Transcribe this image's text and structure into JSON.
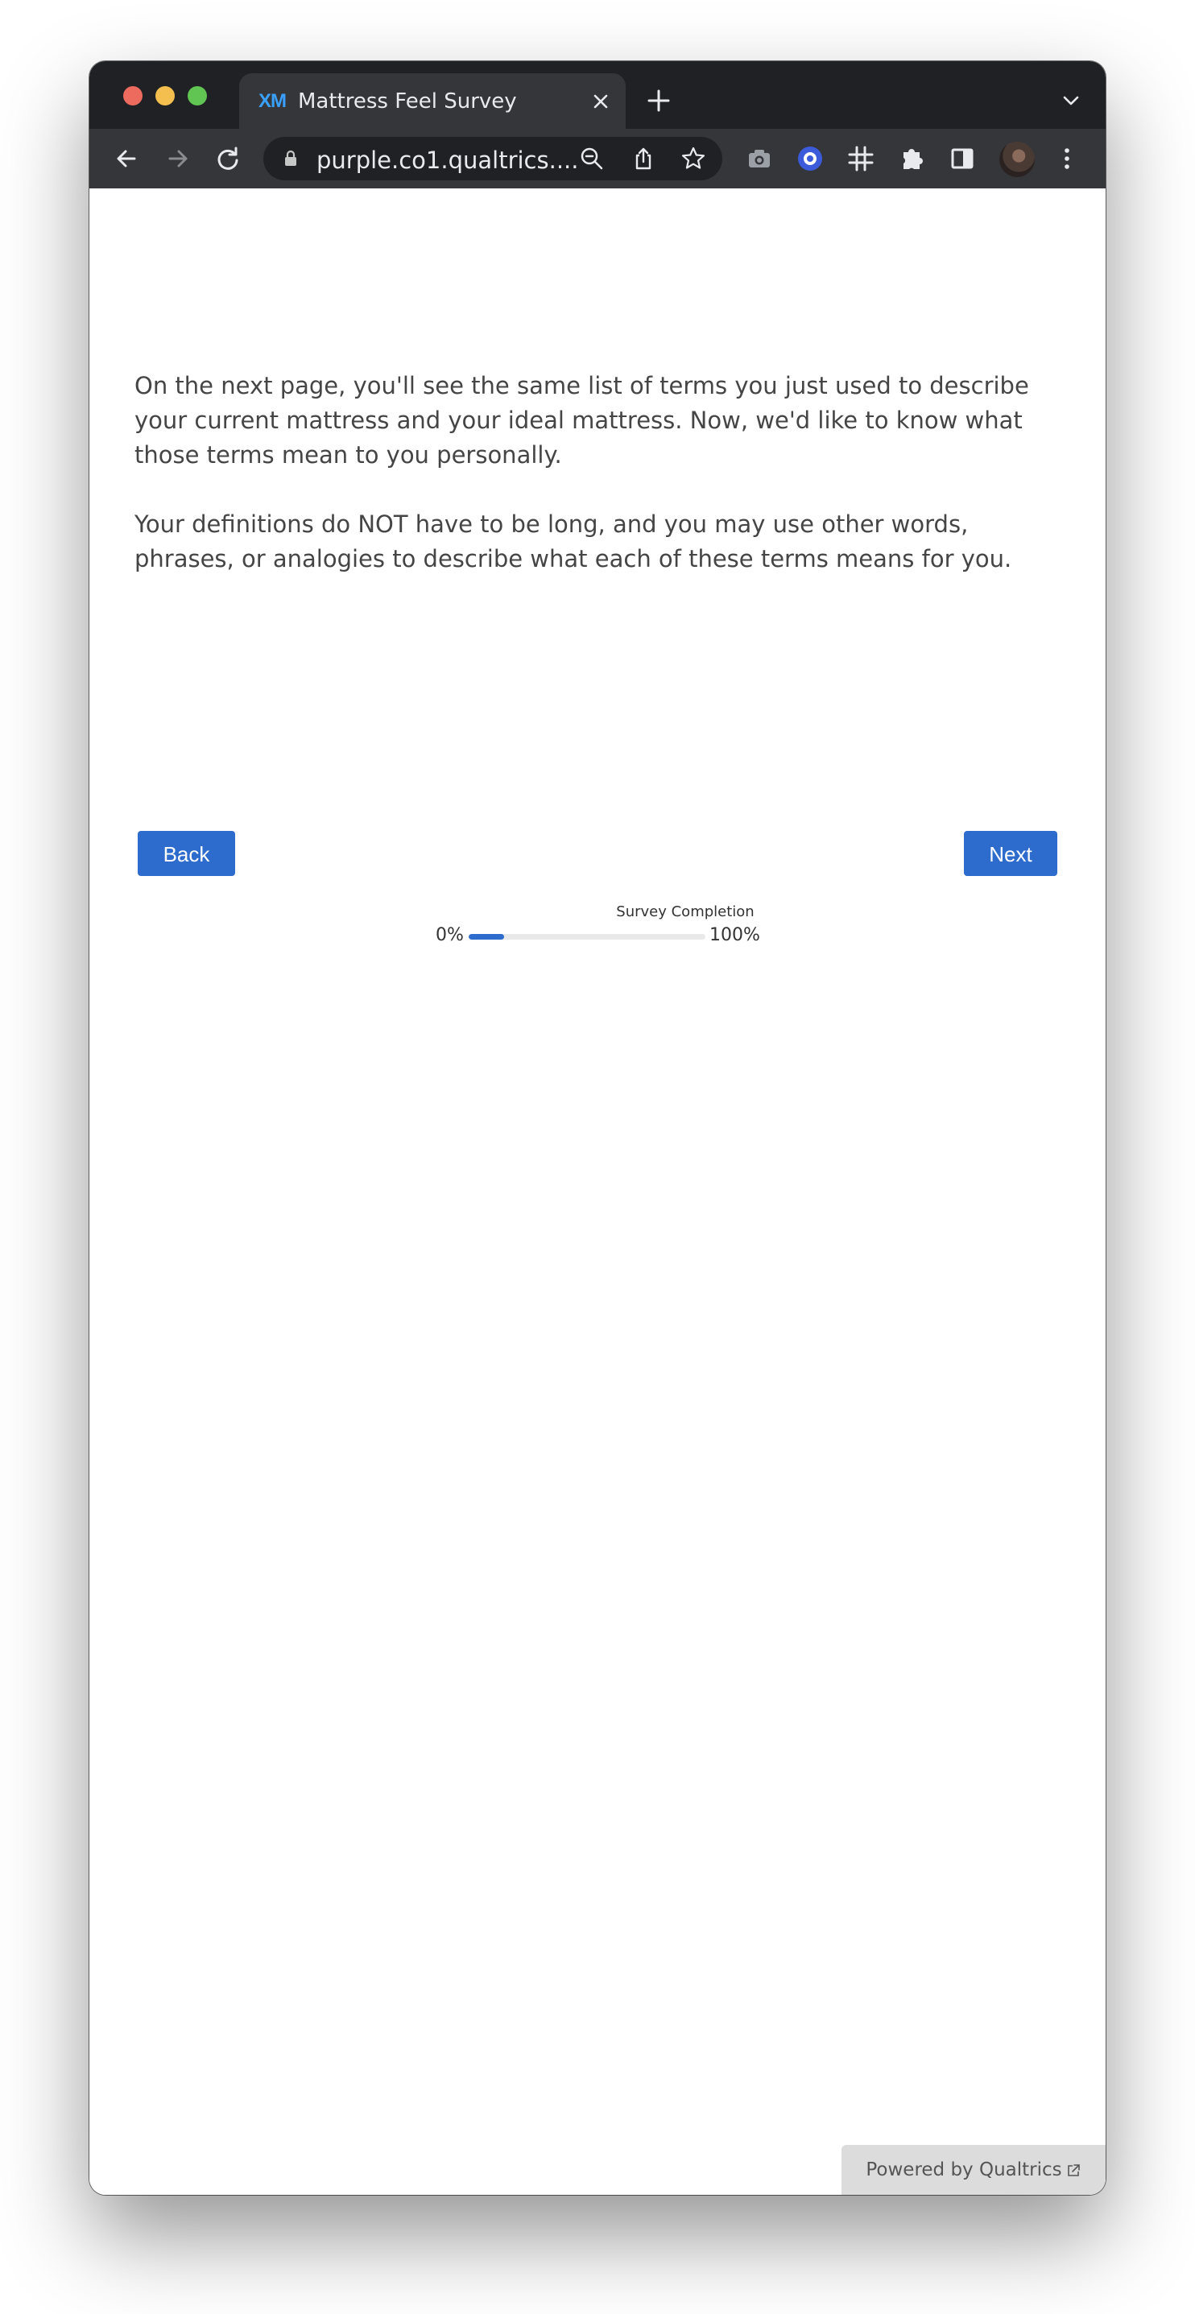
{
  "browser": {
    "tab_title": "Mattress Feel Survey",
    "favicon_text": "XM",
    "url": "purple.co1.qualtrics....",
    "icons": [
      "back-arrow-icon",
      "forward-arrow-icon",
      "reload-icon",
      "lock-icon",
      "zoom-out-icon",
      "share-icon",
      "star-icon",
      "camera-icon",
      "extension-target-icon",
      "hashtag-icon",
      "puzzle-icon",
      "sidebar-icon",
      "avatar",
      "more-vert-icon"
    ]
  },
  "survey": {
    "paragraph_1": "On the next page, you'll see the same list of terms you just used to describe your current mattress and your ideal mattress. Now, we'd like to know what those terms mean to you personally.",
    "paragraph_2": "Your definitions do NOT have to be long, and you may use other words, phrases, or analogies to describe what each of these terms means for you.",
    "back_label": "Back",
    "next_label": "Next",
    "progress": {
      "label": "Survey Completion",
      "start_label": "0%",
      "end_label": "100%",
      "percent": 15
    },
    "powered_by": "Powered by Qualtrics"
  },
  "colors": {
    "accent": "#2d6bcc",
    "chrome_dark": "#202124",
    "chrome_toolbar": "#35363a"
  }
}
